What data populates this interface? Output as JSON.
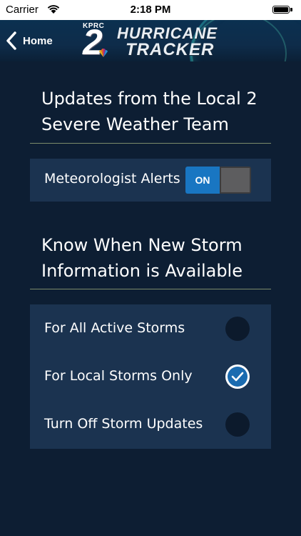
{
  "status_bar": {
    "carrier": "Carrier",
    "time": "2:18 PM"
  },
  "nav": {
    "back_label": "Home",
    "logo": {
      "station": "KPRC",
      "number": "2",
      "title_line1": "HURRICANE",
      "title_line2": "TRACKER"
    }
  },
  "alerts_section": {
    "title_line1": "Updates from the Local 2",
    "title_line2": "Severe Weather Team",
    "row_label": "Meteorologist Alerts",
    "toggle_label": "ON",
    "toggle_on": true
  },
  "storm_section": {
    "title_line1": "Know When New Storm",
    "title_line2": "Information is Available",
    "options": [
      {
        "label": "For All Active Storms",
        "selected": false
      },
      {
        "label": "For Local Storms Only",
        "selected": true
      },
      {
        "label": "Turn Off Storm Updates",
        "selected": false
      }
    ]
  },
  "colors": {
    "background": "#0d1e33",
    "card": "#1b3350",
    "toggle_on": "#1976c2",
    "radio_selected": "#1a6bb0"
  }
}
